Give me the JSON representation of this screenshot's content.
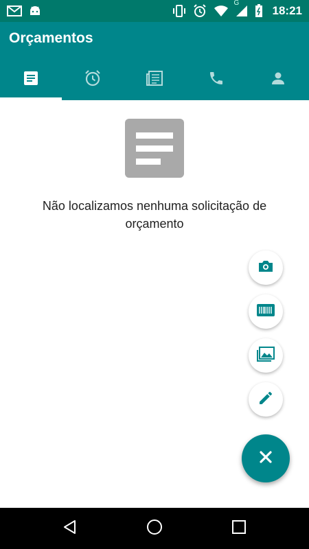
{
  "status_bar": {
    "time": "18:21",
    "icons": [
      "gmail-icon",
      "android-icon",
      "vibrate-icon",
      "alarm-icon",
      "wifi-icon",
      "signal-icon",
      "battery-icon"
    ],
    "network_label": "G"
  },
  "app_bar": {
    "title": "Orçamentos",
    "background_color": "#00868b"
  },
  "tabs": [
    {
      "icon": "document-icon",
      "active": true
    },
    {
      "icon": "alarm-clock-icon",
      "active": false
    },
    {
      "icon": "newspaper-icon",
      "active": false
    },
    {
      "icon": "phone-icon",
      "active": false
    },
    {
      "icon": "person-icon",
      "active": false
    }
  ],
  "empty_state": {
    "icon": "document-lines-icon",
    "message": "Não localizamos nenhuma solicitação de orçamento"
  },
  "fab_menu": {
    "items": [
      {
        "icon": "camera-icon"
      },
      {
        "icon": "barcode-icon"
      },
      {
        "icon": "image-icon"
      },
      {
        "icon": "pencil-icon"
      }
    ],
    "main_icon": "close-icon",
    "accent_color": "#00868b"
  },
  "nav_bar": {
    "buttons": [
      "back-icon",
      "home-icon",
      "recents-icon"
    ]
  }
}
